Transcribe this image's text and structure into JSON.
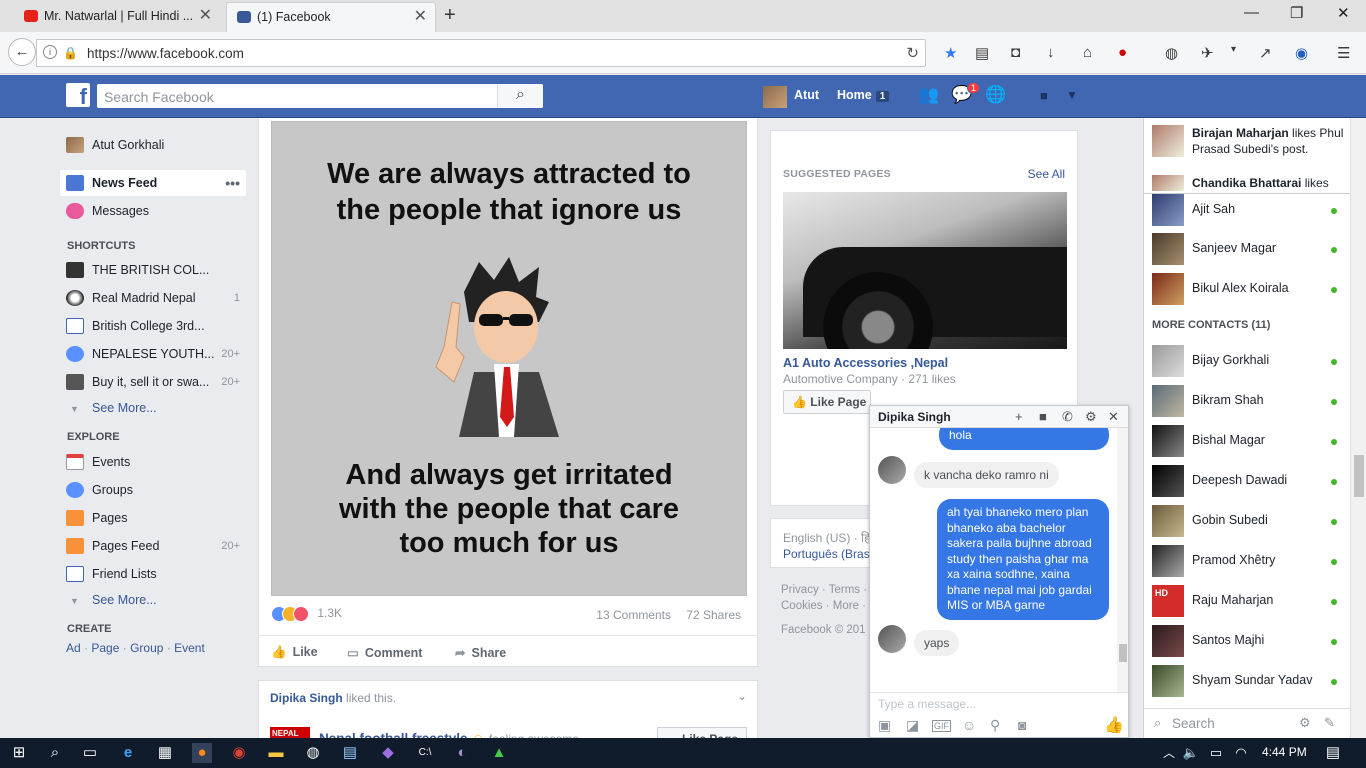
{
  "browser": {
    "tabs": [
      {
        "title": "Mr. Natwarlal | Full Hindi ...",
        "icon": "youtube-icon",
        "active": false
      },
      {
        "title": "(1) Facebook",
        "icon": "facebook-icon",
        "active": true
      }
    ],
    "url": "https://www.facebook.com"
  },
  "header": {
    "search_placeholder": "Search Facebook",
    "user_name": "Atut",
    "home_label": "Home",
    "home_count": "1",
    "notification_count": "1"
  },
  "leftnav": {
    "profile": "Atut Gorkhali",
    "news_feed": "News Feed",
    "messages": "Messages",
    "shortcuts_heading": "SHORTCUTS",
    "shortcuts": [
      {
        "label": "THE BRITISH COL...",
        "count": ""
      },
      {
        "label": "Real Madrid Nepal",
        "count": "1"
      },
      {
        "label": "British College 3rd...",
        "count": ""
      },
      {
        "label": "NEPALESE YOUTH...",
        "count": "20+"
      },
      {
        "label": "Buy it, sell it or swa...",
        "count": "20+"
      }
    ],
    "see_more_1": "See More...",
    "explore_heading": "EXPLORE",
    "explore": [
      {
        "label": "Events",
        "count": ""
      },
      {
        "label": "Groups",
        "count": ""
      },
      {
        "label": "Pages",
        "count": ""
      },
      {
        "label": "Pages Feed",
        "count": "20+"
      },
      {
        "label": "Friend Lists",
        "count": ""
      }
    ],
    "see_more_2": "See More...",
    "create_heading": "CREATE",
    "create_links": [
      "Ad",
      "Page",
      "Group",
      "Event"
    ]
  },
  "post": {
    "image_text_top": "We are always attracted to the people that ignore us",
    "image_text_bottom": "And always get irritated with the people that care too much for us",
    "reaction_count": "1.3K",
    "comments": "13 Comments",
    "shares": "72 Shares",
    "actions": [
      "Like",
      "Comment",
      "Share"
    ]
  },
  "story2": {
    "actor": "Dipika Singh",
    "action": "liked this.",
    "page_name": "Nepal football freestyle",
    "feeling": "feeling awesome",
    "like_label": "Like Page"
  },
  "suggested": {
    "heading": "SUGGESTED PAGES",
    "see_all": "See All",
    "page_name": "A1 Auto Accessories ,Nepal",
    "category": "Automotive Company · 271 likes",
    "like_button": "Like Page"
  },
  "language": {
    "current": "English (US) · हि",
    "other": "Português (Bras"
  },
  "footer": {
    "line1": "Privacy · Terms ·",
    "line2": "Cookies · More ·",
    "copyright": "Facebook © 201"
  },
  "chat": {
    "name": "Dipika Singh",
    "messages": [
      {
        "from": "me",
        "text": "hola"
      },
      {
        "from": "them",
        "text": "k vancha deko ramro ni"
      },
      {
        "from": "me",
        "text": "ah tyai bhaneko mero plan bhaneko aba bachelor sakera paila bujhne abroad study then paisha ghar ma xa xaina sodhne, xaina bhane nepal mai job gardai MIS or MBA garne"
      },
      {
        "from": "them",
        "text": "yaps"
      }
    ],
    "input_placeholder": "Type a message..."
  },
  "sidebar": {
    "ticker": [
      {
        "name": "Birajan Maharjan",
        "text": "likes Phul Prasad Subedi's post."
      },
      {
        "name": "Chandika Bhattarai",
        "text": "likes"
      }
    ],
    "contacts": [
      "Ajit Sah",
      "Sanjeev Magar",
      "Bikul Alex Koirala"
    ],
    "more_contacts_heading": "MORE CONTACTS (11)",
    "more_contacts": [
      "Bijay Gorkhali",
      "Bikram Shah",
      "Bishal Magar",
      "Deepesh Dawadi",
      "Gobin Subedi",
      "Pramod Xhêtry",
      "Raju Maharjan",
      "Santos Majhi",
      "Shyam Sundar Yadav"
    ],
    "search_placeholder": "Search"
  },
  "taskbar": {
    "time": "4:44 PM"
  },
  "colors": {
    "fb_blue": "#4267b2",
    "link": "#365899",
    "online": "#42b72a",
    "chat_bubble": "#3578e5"
  }
}
